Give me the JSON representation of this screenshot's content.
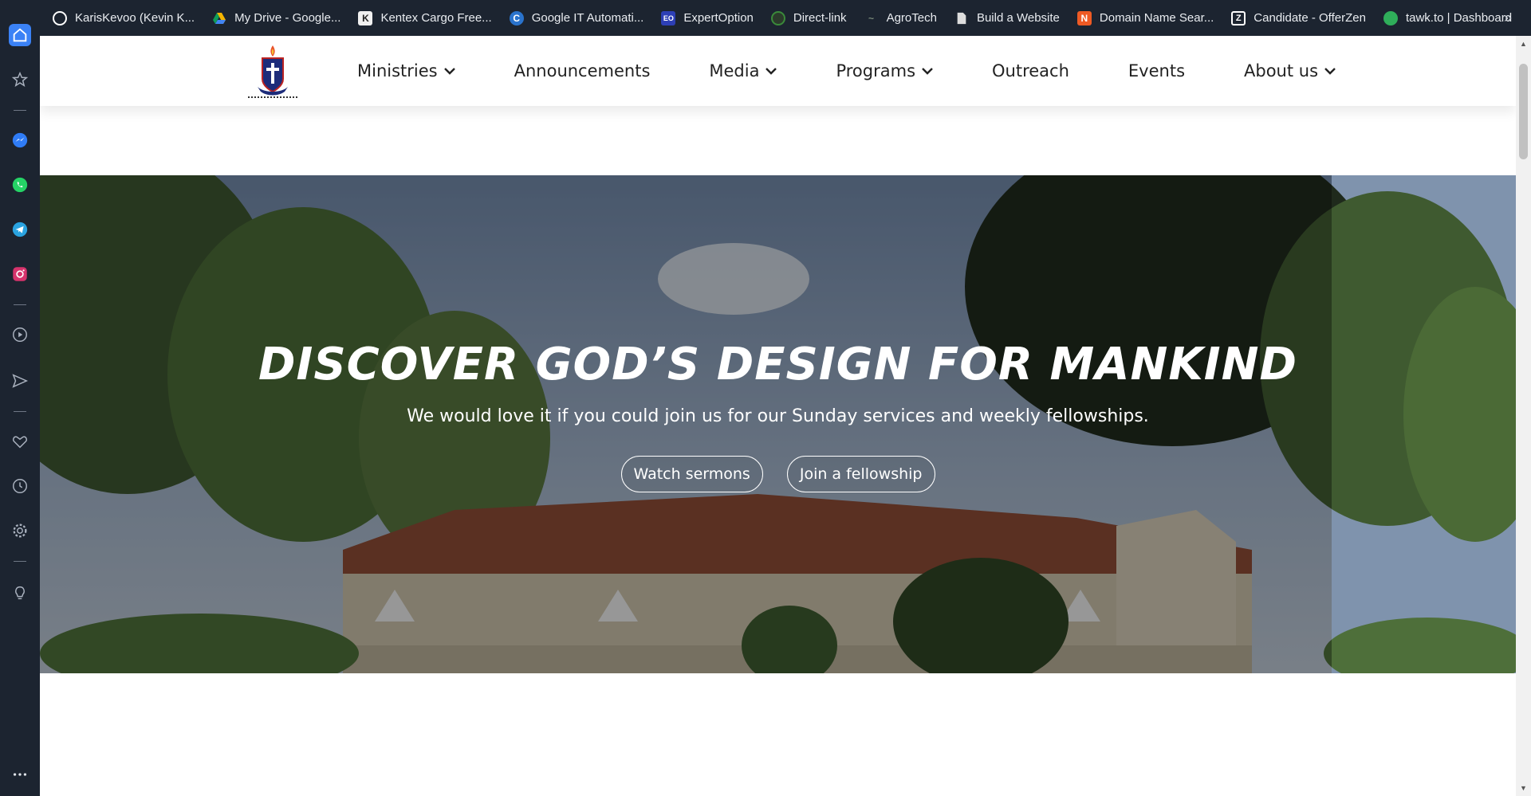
{
  "bookmarks": [
    {
      "label": "KarisKevoo (Kevin K...",
      "icon": "github-icon",
      "color": "#ffffff"
    },
    {
      "label": "My Drive - Google...",
      "icon": "google-drive-icon",
      "color": "#f4b400"
    },
    {
      "label": "Kentex Cargo Free...",
      "icon": "kentex-icon",
      "color": "#333333"
    },
    {
      "label": "Google IT Automati...",
      "icon": "coursera-icon",
      "color": "#2a73cc"
    },
    {
      "label": "ExpertOption",
      "icon": "expertoption-icon",
      "color": "#2d3fb5"
    },
    {
      "label": "Direct-link",
      "icon": "globe-icon",
      "color": "#3a8a3a"
    },
    {
      "label": "AgroTech",
      "icon": "agrotech-icon",
      "color": "#5a6a5a"
    },
    {
      "label": "Build a Website",
      "icon": "document-icon",
      "color": "#dddddd"
    },
    {
      "label": "Domain Name Sear...",
      "icon": "namecheap-icon",
      "color": "#ee5a24"
    },
    {
      "label": "Candidate - OfferZen",
      "icon": "offerzen-icon",
      "color": "#ffffff"
    },
    {
      "label": "tawk.to | Dashboard",
      "icon": "tawk-icon",
      "color": "#2fae5a"
    }
  ],
  "bookmarks_more": "»",
  "sidebar_icons": [
    "home-icon",
    "star-icon",
    "messenger-icon",
    "whatsapp-icon",
    "telegram-icon",
    "instagram-icon",
    "player-icon",
    "send-icon",
    "heart-icon",
    "history-icon",
    "settings-icon",
    "lightbulb-icon",
    "more-icon"
  ],
  "nav": {
    "items": [
      {
        "label": "Ministries",
        "dropdown": true
      },
      {
        "label": "Announcements",
        "dropdown": false
      },
      {
        "label": "Media",
        "dropdown": true
      },
      {
        "label": "Programs",
        "dropdown": true
      },
      {
        "label": "Outreach",
        "dropdown": false
      },
      {
        "label": "Events",
        "dropdown": false
      },
      {
        "label": "About us",
        "dropdown": true
      }
    ]
  },
  "hero": {
    "title": "DISCOVER GOD’S DESIGN FOR MANKIND",
    "subtitle": "We would love it if you could join us for our Sunday services and weekly fellowships.",
    "buttons": [
      "Watch sermons",
      "Join a fellowship"
    ]
  },
  "colors": {
    "browser_chrome": "#1c2430",
    "page_background": "#ffffff",
    "nav_text": "#222222",
    "hero_text": "#ffffff"
  }
}
